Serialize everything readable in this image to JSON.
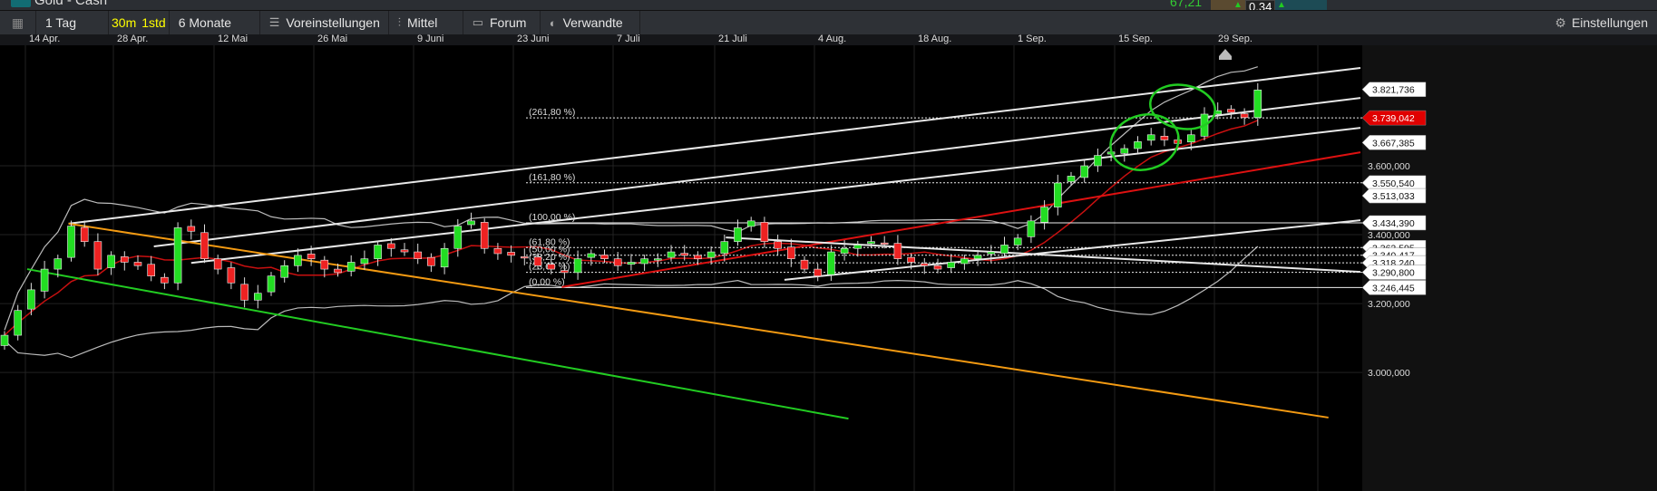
{
  "header": {
    "instrument": "Gold - Cash",
    "value": "67,21",
    "change": "0,34"
  },
  "toolbar": {
    "period": "1 Tag",
    "interval_30m": "30m",
    "interval_1std": "1std",
    "range": "6 Monate",
    "presets": "Voreinstellungen",
    "indicators": "Mittel",
    "forum": "Forum",
    "related": "Verwandte",
    "settings": "Einstellungen"
  },
  "colors": {
    "up": "#22dd22",
    "down": "#ee2222",
    "background": "#000000",
    "accent_current": "#e00000",
    "ma": "#c81010",
    "bands": "#bbbbbb",
    "orange_line": "#f39a12",
    "green_line": "#22cc22"
  },
  "chart_data": {
    "type": "candlestick",
    "date_ticks": [
      "14 Apr.",
      "28 Apr.",
      "12 Mai",
      "26 Mai",
      "9 Juni",
      "23 Juni",
      "7 Juli",
      "21 Juli",
      "4 Aug.",
      "18 Aug.",
      "1 Sep.",
      "15 Sep.",
      "29 Sep."
    ],
    "price_ticks": [
      "3.600,000",
      "3.400,000",
      "3.200,000",
      "3.000,000"
    ],
    "price_tick_values": [
      3600,
      3400,
      3200,
      3000
    ],
    "ylim": [
      2850,
      3920
    ],
    "grid": true,
    "closes": [
      3108,
      3180,
      3240,
      3300,
      3330,
      3425,
      3380,
      3300,
      3340,
      3320,
      3310,
      3280,
      3260,
      3420,
      3410,
      3330,
      3300,
      3260,
      3210,
      3230,
      3280,
      3310,
      3340,
      3330,
      3300,
      3290,
      3320,
      3330,
      3370,
      3360,
      3350,
      3330,
      3310,
      3360,
      3425,
      3440,
      3360,
      3345,
      3340,
      3335,
      3310,
      3300,
      3290,
      3330,
      3345,
      3330,
      3310,
      3320,
      3330,
      3330,
      3350,
      3340,
      3330,
      3350,
      3380,
      3420,
      3440,
      3380,
      3360,
      3330,
      3300,
      3280,
      3350,
      3360,
      3370,
      3380,
      3375,
      3330,
      3320,
      3310,
      3300,
      3320,
      3330,
      3340,
      3350,
      3370,
      3390,
      3440,
      3480,
      3550,
      3570,
      3600,
      3630,
      3640,
      3650,
      3670,
      3690,
      3675,
      3665,
      3690,
      3750,
      3760,
      3755,
      3740,
      3820
    ],
    "price_labels": [
      {
        "text": "3.821,736",
        "value": 3821.736,
        "style": "box"
      },
      {
        "text": "3.739,042",
        "value": 3739.042,
        "style": "current"
      },
      {
        "text": "3.667,385",
        "value": 3667.385,
        "style": "box"
      },
      {
        "text": "3.550,540",
        "value": 3550.54,
        "style": "box"
      },
      {
        "text": "3.513,033",
        "value": 3513.033,
        "style": "box"
      },
      {
        "text": "3.434,390",
        "value": 3434.39,
        "style": "box"
      },
      {
        "text": "3.362,595",
        "value": 3362.595,
        "style": "box"
      },
      {
        "text": "3.340,417",
        "value": 3340.417,
        "style": "box"
      },
      {
        "text": "3.318,240",
        "value": 3318.24,
        "style": "box"
      },
      {
        "text": "3.290,800",
        "value": 3290.8,
        "style": "box"
      },
      {
        "text": "3.246,445",
        "value": 3246.445,
        "style": "box"
      }
    ],
    "fibonacci": [
      {
        "label": "(261,80 %)",
        "value": 3739.042,
        "dash": true
      },
      {
        "label": "(161,80 %)",
        "value": 3550.54,
        "dash": true
      },
      {
        "label": "(100,00 %)",
        "value": 3434.39,
        "dash": false
      },
      {
        "label": "(61,80 %)",
        "value": 3362.595,
        "dash": true
      },
      {
        "label": "(50,00 %)",
        "value": 3340.417,
        "dash": true
      },
      {
        "label": "(38,20 %)",
        "value": 3318.24,
        "dash": true
      },
      {
        "label": "(23,60 %)",
        "value": 3290.8,
        "dash": true
      },
      {
        "label": "(0,00 %)",
        "value": 3246.445,
        "dash": false
      }
    ],
    "trendlines": [
      {
        "color": "#e8e8e8",
        "from": [
          4.8,
          3432
        ],
        "to": [
          101.7,
          3884
        ]
      },
      {
        "color": "#e8e8e8",
        "from": [
          11.2,
          3366
        ],
        "to": [
          101.7,
          3797
        ]
      },
      {
        "color": "#e8e8e8",
        "from": [
          14,
          3318
        ],
        "to": [
          101.7,
          3710
        ]
      },
      {
        "color": "#f39a12",
        "from": [
          4.8,
          3432
        ],
        "to": [
          99.3,
          2869
        ]
      },
      {
        "color": "#22cc22",
        "from": [
          1.7,
          3300
        ],
        "to": [
          63.3,
          2866
        ]
      },
      {
        "color": "#dd1111",
        "from": [
          41.8,
          3248
        ],
        "to": [
          101.7,
          3639
        ]
      },
      {
        "color": "#e8e8e8",
        "from": [
          58.5,
          3269
        ],
        "to": [
          101.7,
          3442
        ]
      },
      {
        "color": "#e8e8e8",
        "from": [
          54.1,
          3392
        ],
        "to": [
          101.7,
          3292
        ]
      }
    ]
  }
}
